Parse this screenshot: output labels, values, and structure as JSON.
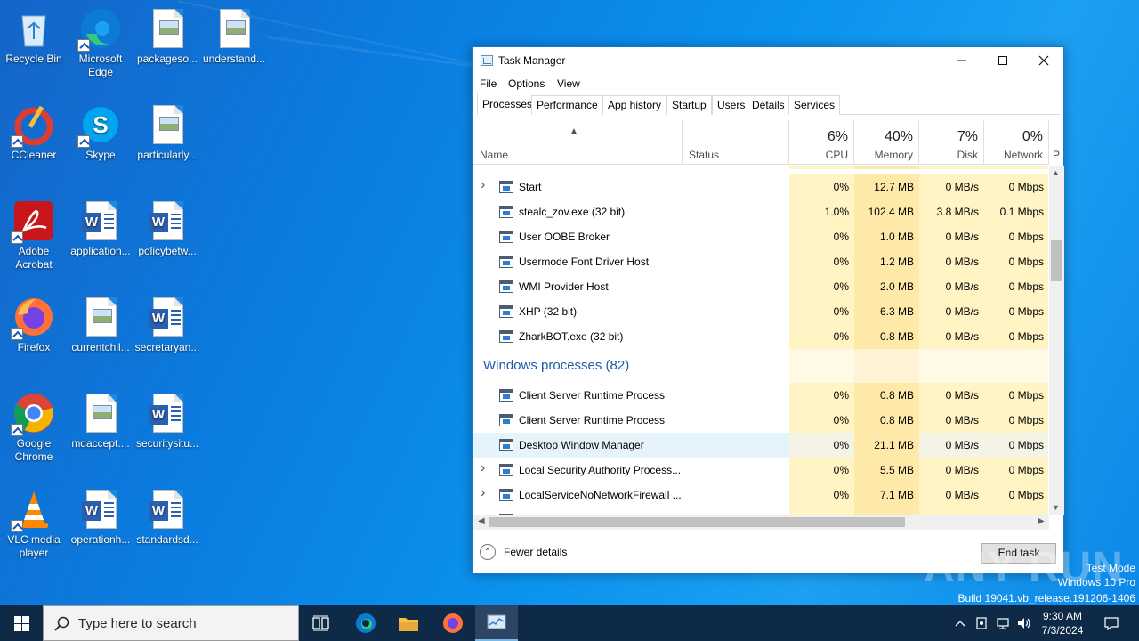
{
  "desktop": {
    "icons": [
      {
        "label": "Recycle Bin",
        "icon": "recycle-bin-icon"
      },
      {
        "label": "Microsoft Edge",
        "icon": "edge-icon"
      },
      {
        "label": "packageso...",
        "icon": "image-file-icon"
      },
      {
        "label": "understand...",
        "icon": "image-file-icon"
      },
      {
        "label": "CCleaner",
        "icon": "ccleaner-icon"
      },
      {
        "label": "Skype",
        "icon": "skype-icon"
      },
      {
        "label": "particularly...",
        "icon": "image-file-icon"
      },
      {
        "label": "Adobe Acrobat",
        "icon": "acrobat-icon"
      },
      {
        "label": "application...",
        "icon": "word-file-icon"
      },
      {
        "label": "policybetw...",
        "icon": "word-file-icon"
      },
      {
        "label": "Firefox",
        "icon": "firefox-icon"
      },
      {
        "label": "currentchil...",
        "icon": "image-file-icon"
      },
      {
        "label": "secretaryan...",
        "icon": "word-file-icon"
      },
      {
        "label": "Google Chrome",
        "icon": "chrome-icon"
      },
      {
        "label": "mdaccept....",
        "icon": "image-file-icon"
      },
      {
        "label": "securitysitu...",
        "icon": "word-file-icon"
      },
      {
        "label": "VLC media player",
        "icon": "vlc-icon"
      },
      {
        "label": "operationh...",
        "icon": "word-file-icon"
      },
      {
        "label": "standardsd...",
        "icon": "word-file-icon"
      }
    ]
  },
  "taskmanager": {
    "title": "Task Manager",
    "menu": [
      "File",
      "Options",
      "View"
    ],
    "tabs": [
      "Processes",
      "Performance",
      "App history",
      "Startup",
      "Users",
      "Details",
      "Services"
    ],
    "active_tab": "Processes",
    "columns": {
      "name": "Name",
      "status": "Status",
      "cpu": {
        "pct": "6%",
        "label": "CPU"
      },
      "memory": {
        "pct": "40%",
        "label": "Memory"
      },
      "disk": {
        "pct": "7%",
        "label": "Disk"
      },
      "network": {
        "pct": "0%",
        "label": "Network"
      },
      "power_partial": "P"
    },
    "rows_top": [
      {
        "name": "Start",
        "expandable": true,
        "cpu": "0%",
        "mem": "12.7 MB",
        "disk": "0 MB/s",
        "net": "0 Mbps"
      },
      {
        "name": "stealc_zov.exe (32 bit)",
        "expandable": false,
        "cpu": "1.0%",
        "mem": "102.4 MB",
        "disk": "3.8 MB/s",
        "net": "0.1 Mbps"
      },
      {
        "name": "User OOBE Broker",
        "expandable": false,
        "cpu": "0%",
        "mem": "1.0 MB",
        "disk": "0 MB/s",
        "net": "0 Mbps"
      },
      {
        "name": "Usermode Font Driver Host",
        "expandable": false,
        "cpu": "0%",
        "mem": "1.2 MB",
        "disk": "0 MB/s",
        "net": "0 Mbps"
      },
      {
        "name": "WMI Provider Host",
        "expandable": false,
        "cpu": "0%",
        "mem": "2.0 MB",
        "disk": "0 MB/s",
        "net": "0 Mbps"
      },
      {
        "name": "XHP (32 bit)",
        "expandable": false,
        "cpu": "0%",
        "mem": "6.3 MB",
        "disk": "0 MB/s",
        "net": "0 Mbps"
      },
      {
        "name": "ZharkBOT.exe (32 bit)",
        "expandable": false,
        "cpu": "0%",
        "mem": "0.8 MB",
        "disk": "0 MB/s",
        "net": "0 Mbps"
      }
    ],
    "group_label": "Windows processes (82)",
    "rows_bottom": [
      {
        "name": "Client Server Runtime Process",
        "expandable": false,
        "cpu": "0%",
        "mem": "0.8 MB",
        "disk": "0 MB/s",
        "net": "0 Mbps"
      },
      {
        "name": "Client Server Runtime Process",
        "expandable": false,
        "cpu": "0%",
        "mem": "0.8 MB",
        "disk": "0 MB/s",
        "net": "0 Mbps"
      },
      {
        "name": "Desktop Window Manager",
        "expandable": false,
        "selected": true,
        "cpu": "0%",
        "mem": "21.1 MB",
        "disk": "0 MB/s",
        "net": "0 Mbps"
      },
      {
        "name": "Local Security Authority Process...",
        "expandable": true,
        "cpu": "0%",
        "mem": "5.5 MB",
        "disk": "0 MB/s",
        "net": "0 Mbps"
      },
      {
        "name": "LocalServiceNoNetworkFirewall ...",
        "expandable": true,
        "cpu": "0%",
        "mem": "7.1 MB",
        "disk": "0 MB/s",
        "net": "0 Mbps"
      }
    ],
    "fewer_details": "Fewer details",
    "end_task": "End task"
  },
  "watermark": {
    "line1": "Test Mode",
    "line2": "Windows 10 Pro",
    "line3": "Build 19041.vb_release.191206-1406",
    "brand": "ANY RUN"
  },
  "taskbar": {
    "search_placeholder": "Type here to search",
    "time": "9:30 AM",
    "date": "7/3/2024"
  },
  "colors": {
    "accent": "#1679d6",
    "cpu_cell": "#fff4c4",
    "mem_cell": "#ffe9a8",
    "selected_row": "#e5f3fb",
    "group_text": "#1e5ca8",
    "taskbar": "#0f2a47"
  }
}
